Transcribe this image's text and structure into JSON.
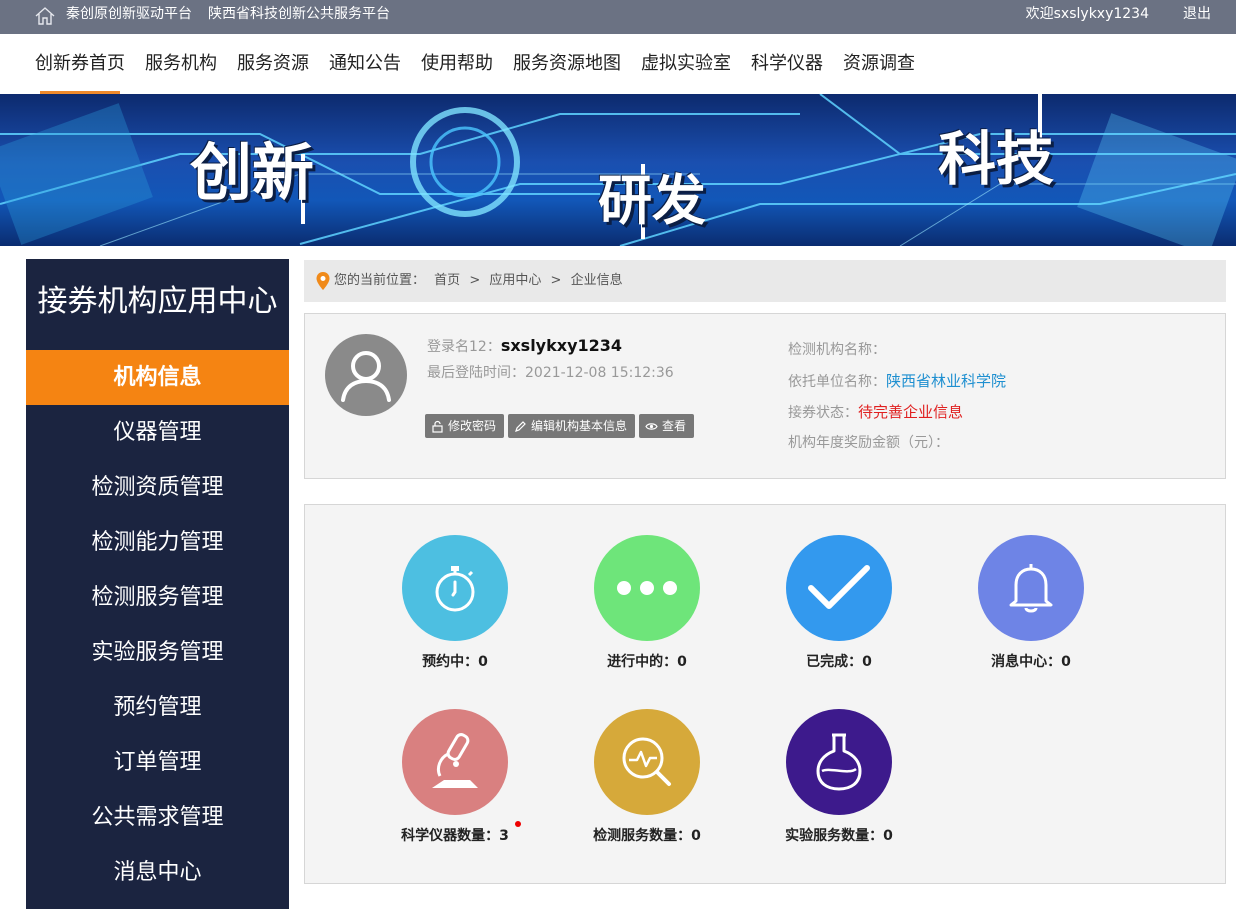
{
  "topbar": {
    "links_left": [
      "秦创原创新驱动平台",
      "陕西省科技创新公共服务平台"
    ],
    "welcome": "欢迎sxslykxy1234",
    "logout": "退出"
  },
  "nav": {
    "items": [
      "创新券首页",
      "服务机构",
      "服务资源",
      "通知公告",
      "使用帮助",
      "服务资源地图",
      "虚拟实验室",
      "科学仪器",
      "资源调查"
    ]
  },
  "banner": {
    "words": [
      "创新",
      "研发",
      "科技"
    ]
  },
  "sidebar": {
    "title": "接券机构应用中心",
    "items": [
      "机构信息",
      "仪器管理",
      "检测资质管理",
      "检测能力管理",
      "检测服务管理",
      "实验服务管理",
      "预约管理",
      "订单管理",
      "公共需求管理",
      "消息中心"
    ]
  },
  "breadcrumb": {
    "prefix": "您的当前位置：",
    "path": [
      "首页",
      ">",
      "应用中心",
      ">",
      "企业信息"
    ]
  },
  "profile": {
    "login_label": "登录名12：",
    "login_name": "sxslykxy1234",
    "last_login": "最后登陆时间：2021-12-08 15:12:36",
    "buttons": [
      "修改密码",
      "编辑机构基本信息",
      "查看"
    ],
    "org_name_label": "检测机构名称：",
    "parent_label": "依托单位名称：",
    "parent_value": "陕西省林业科学院",
    "status_label": "接券状态：",
    "status_value": "待完善企业信息",
    "award_label": "机构年度奖励金额（元）："
  },
  "stats": [
    {
      "label": "预约中：0",
      "color": "#4dbfe1",
      "icon": "stopwatch-icon"
    },
    {
      "label": "进行中的：0",
      "color": "#6ee57a",
      "icon": "more-dots-icon"
    },
    {
      "label": "已完成：0",
      "color": "#3399ee",
      "icon": "checkmark-icon"
    },
    {
      "label": "消息中心：0",
      "color": "#6e84e6",
      "icon": "bell-icon"
    },
    {
      "label": "科学仪器数量：3",
      "color": "#d98080",
      "icon": "microscope-icon"
    },
    {
      "label": "检测服务数量：0",
      "color": "#d6a93a",
      "icon": "analysis-search-icon"
    },
    {
      "label": "实验服务数量：0",
      "color": "#3d1a8c",
      "icon": "flask-icon"
    }
  ]
}
